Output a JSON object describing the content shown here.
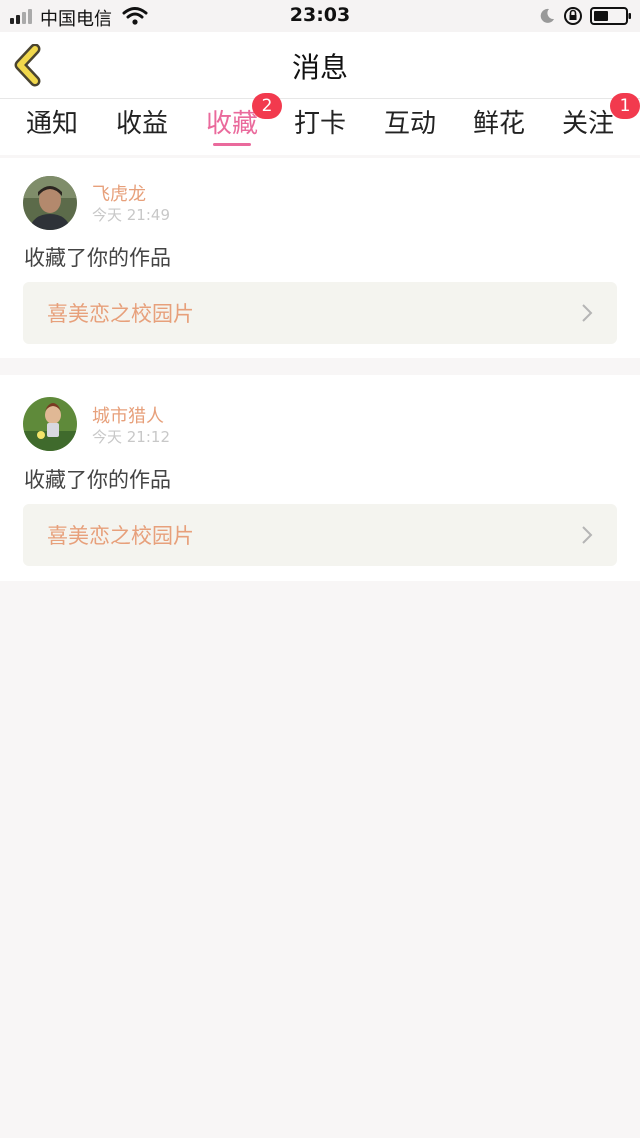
{
  "status_bar": {
    "carrier": "中国电信",
    "time": "23:03"
  },
  "header": {
    "title": "消息"
  },
  "tabs": [
    {
      "label": "通知"
    },
    {
      "label": "收益"
    },
    {
      "label": "收藏",
      "badge": "2",
      "active": true
    },
    {
      "label": "打卡"
    },
    {
      "label": "互动"
    },
    {
      "label": "鲜花"
    },
    {
      "label": "关注",
      "badge": "1"
    }
  ],
  "messages": [
    {
      "username": "飞虎龙",
      "time": "今天 21:49",
      "text": "收藏了你的作品",
      "work_title": "喜美恋之校园片"
    },
    {
      "username": "城市猎人",
      "time": "今天 21:12",
      "text": "收藏了你的作品",
      "work_title": "喜美恋之校园片"
    }
  ],
  "colors": {
    "accent_pink": "#ea6a9c",
    "badge_red": "#f23a4e",
    "username_orange": "#e7a07b",
    "back_arrow_yellow": "#f1d84c"
  },
  "icons": {
    "back": "chevron-left-icon",
    "work_link": "chevron-right-icon"
  }
}
